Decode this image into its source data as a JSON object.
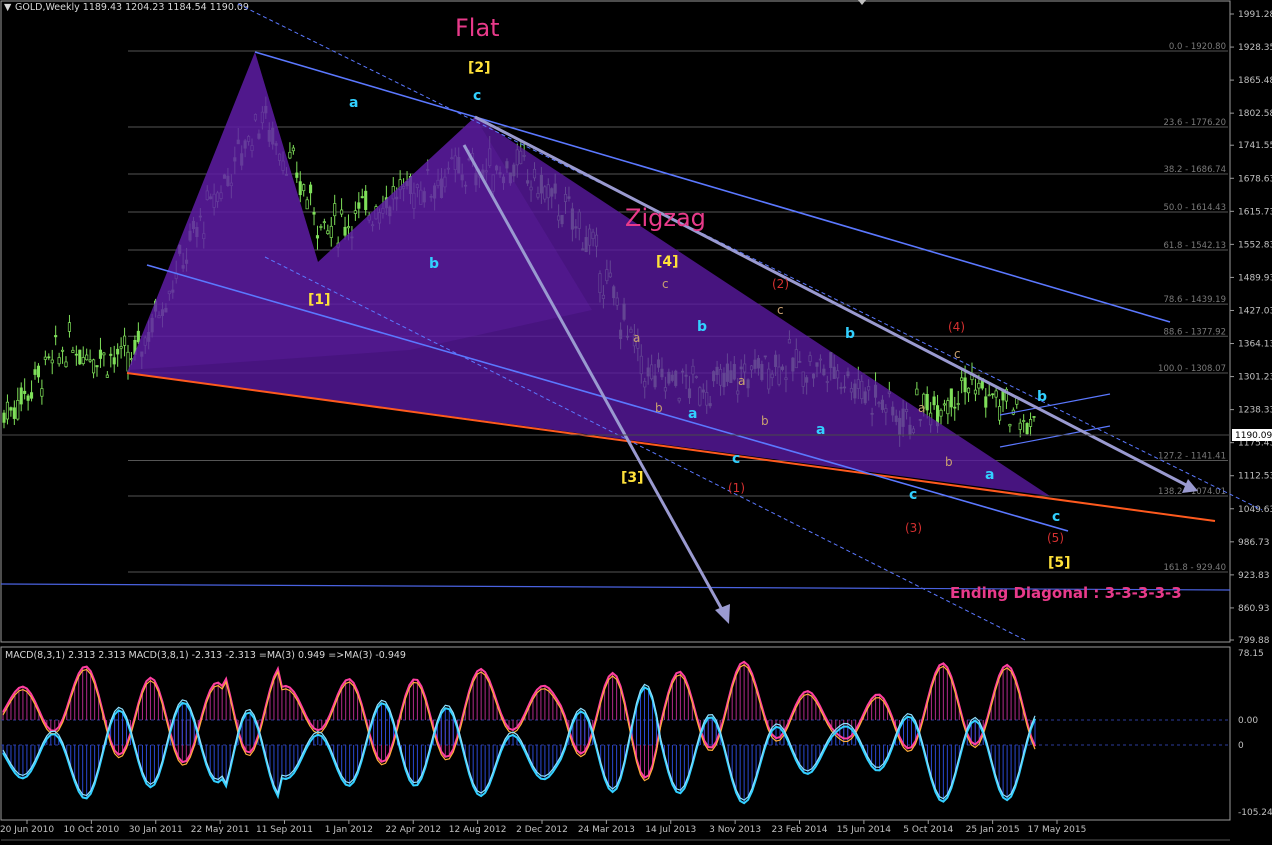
{
  "window": {
    "header": "GOLD,Weekly  1189.43 1204.23 1184.54 1190.09",
    "menu_glyph": "▼"
  },
  "price_axis": {
    "ticks": [
      "1991.28",
      "1928.35",
      "1865.48",
      "1802.58",
      "1741.55",
      "1678.63",
      "1615.73",
      "1552.83",
      "1489.93",
      "1427.03",
      "1364.13",
      "1301.23",
      "1238.33",
      "1175.43",
      "1112.53",
      "1049.63",
      "986.73",
      "923.83",
      "860.93",
      "799.88"
    ],
    "current": "1190.09"
  },
  "time_axis": {
    "ticks": [
      "20 Jun 2010",
      "10 Oct 2010",
      "30 Jan 2011",
      "22 May 2011",
      "11 Sep 2011",
      "1 Jan 2012",
      "22 Apr 2012",
      "12 Aug 2012",
      "2 Dec 2012",
      "24 Mar 2013",
      "14 Jul 2013",
      "3 Nov 2013",
      "23 Feb 2014",
      "15 Jun 2014",
      "5 Oct 2014",
      "25 Jan 2015",
      "17 May 2015"
    ]
  },
  "fib_levels": [
    {
      "label": "0.0 - 1920.80",
      "price": 1920.8
    },
    {
      "label": "23.6 - 1776.20",
      "price": 1776.2
    },
    {
      "label": "38.2 - 1686.74",
      "price": 1686.74
    },
    {
      "label": "50.0 - 1614.43",
      "price": 1614.43
    },
    {
      "label": "61.8 - 1542.13",
      "price": 1542.13
    },
    {
      "label": "78.6 - 1439.19",
      "price": 1439.19
    },
    {
      "label": "88.6 - 1377.92",
      "price": 1377.92
    },
    {
      "label": "100.0 - 1308.07",
      "price": 1308.07
    },
    {
      "label": "127.2 - 1141.41",
      "price": 1141.41
    },
    {
      "label": "138.2 - 1074.01",
      "price": 1074.01
    },
    {
      "label": "161.8 - 929.40",
      "price": 929.4
    }
  ],
  "annotations": {
    "flat": "Flat",
    "zigzag": "Zigzag",
    "ending_diagonal": "Ending Diagonal : 3-3-3-3-3",
    "w1": "[1]",
    "w2": "[2]",
    "w3": "[3]",
    "w4": "[4]",
    "w5": "[5]",
    "a": "a",
    "b": "b",
    "c": "c",
    "r1": "(1)",
    "r2": "(2)",
    "r3": "(3)",
    "r4": "(4)",
    "r5": "(5)"
  },
  "macd": {
    "header": "MACD(8,3,1) 2.313 2.313  MACD(3,8,1) -2.313 -2.313  =MA(3) 0.949  =>MA(3) -0.949",
    "ticks": [
      "78.15",
      "0.00",
      "0",
      "-105.24"
    ]
  },
  "colors": {
    "bull_candle": "#7fe05a",
    "channel": "#5b78ff",
    "zigzag_fill": "#5b1aa3",
    "orange_line": "#ff5a1e",
    "arrow": "#9a9ad0",
    "macd_pink": "#ff3fa0",
    "macd_cyan": "#32d0ff",
    "yellow": "#ffe23a",
    "magenta": "#e83a8a",
    "red": "#d43030"
  },
  "chart_data": {
    "type": "line",
    "title": "GOLD,Weekly",
    "x": [
      "20 Jun 2010",
      "10 Oct 2010",
      "30 Jan 2011",
      "22 May 2011",
      "11 Sep 2011",
      "1 Jan 2012",
      "22 Apr 2012",
      "12 Aug 2012",
      "2 Dec 2012",
      "24 Mar 2013",
      "14 Jul 2013",
      "3 Nov 2013",
      "23 Feb 2014",
      "15 Jun 2014",
      "5 Oct 2014",
      "25 Jan 2015",
      "17 May 2015"
    ],
    "series": [
      {
        "values": [
          1230,
          1360,
          1330,
          1580,
          1800,
          1580,
          1640,
          1690,
          1700,
          1580,
          1300,
          1280,
          1330,
          1310,
          1220,
          1290,
          1200
        ]
      }
    ],
    "ylim": [
      799.88,
      1991.28
    ],
    "ohlc_last": {
      "open": 1189.43,
      "high": 1204.23,
      "low": 1184.54,
      "close": 1190.09
    }
  }
}
